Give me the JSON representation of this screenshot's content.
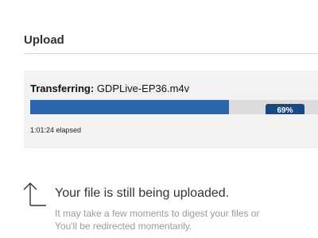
{
  "section": {
    "title": "Upload"
  },
  "transfer": {
    "status_label": "Transferring:",
    "filename": "GDPLive-EP36.m4v",
    "progress_percent": 69,
    "progress_text": "69%",
    "elapsed": "1:01:24 elapsed"
  },
  "message": {
    "heading": "Your file is still being uploaded.",
    "detail_line1": "It may take a few moments to digest your files or",
    "detail_line2": "You'll be redirected momentarily."
  },
  "icons": {
    "upload": "upload-arrow-icon"
  },
  "colors": {
    "progress_fill": "#2a64ad",
    "progress_pill": "#164a86",
    "panel_bg": "#f2f2f2",
    "muted_text": "#9a9a9a"
  }
}
